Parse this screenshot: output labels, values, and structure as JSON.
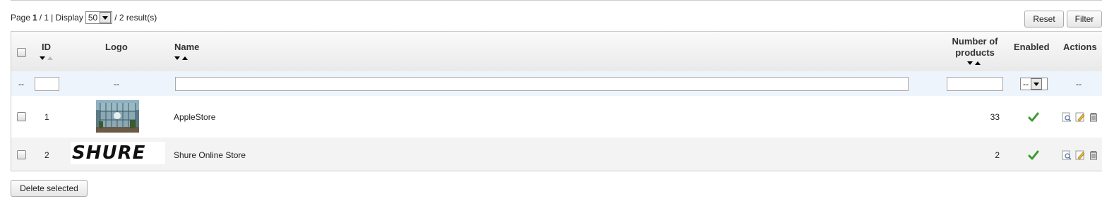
{
  "pagination": {
    "page_label": "Page",
    "page_current": "1",
    "page_total": "/ 1",
    "display_label": "| Display",
    "per_page": "50",
    "results": "/ 2 result(s)"
  },
  "toolbar": {
    "reset_label": "Reset",
    "filter_label": "Filter"
  },
  "columns": {
    "id": "ID",
    "logo": "Logo",
    "name": "Name",
    "products_line1": "Number of",
    "products_line2": "products",
    "enabled": "Enabled",
    "actions": "Actions"
  },
  "filters": {
    "dash": "--",
    "enabled_select": "--"
  },
  "rows": [
    {
      "id": "1",
      "name": "AppleStore",
      "products": "33",
      "enabled": true,
      "logo": "apple-store-photo"
    },
    {
      "id": "2",
      "name": "Shure Online Store",
      "products": "2",
      "enabled": true,
      "logo": "shure-logo",
      "logo_text": "SHURE"
    }
  ],
  "footer": {
    "delete_label": "Delete selected"
  },
  "colors": {
    "check_green": "#3a9a2e",
    "header_bg": "#e9e9e9",
    "filter_bg": "#eef4fb"
  }
}
